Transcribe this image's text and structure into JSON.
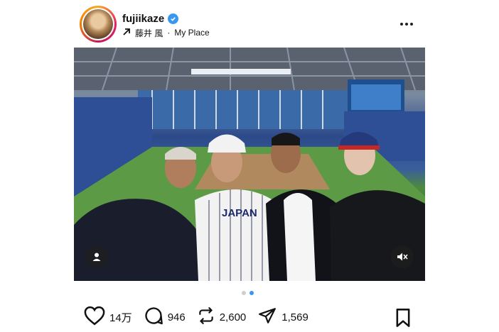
{
  "post": {
    "username": "fujiikaze",
    "verified": true,
    "display_name": "藤井 風",
    "separator": "·",
    "location": "My Place"
  },
  "icons": {
    "more": "more-options-icon",
    "user_tag": "user-icon",
    "mute": "muted-speaker-icon",
    "like": "heart-icon",
    "comment": "comment-bubble-icon",
    "repost": "repost-icon",
    "share": "send-icon",
    "save": "bookmark-icon"
  },
  "carousel": {
    "total": 2,
    "active": 2
  },
  "stats": {
    "likes": "14万",
    "comments": "946",
    "reposts": "2,600",
    "shares": "1,569"
  },
  "colors": {
    "verified": "#3897f0",
    "active_dot": "#3897f0",
    "inactive_dot": "#cfcfcf"
  }
}
